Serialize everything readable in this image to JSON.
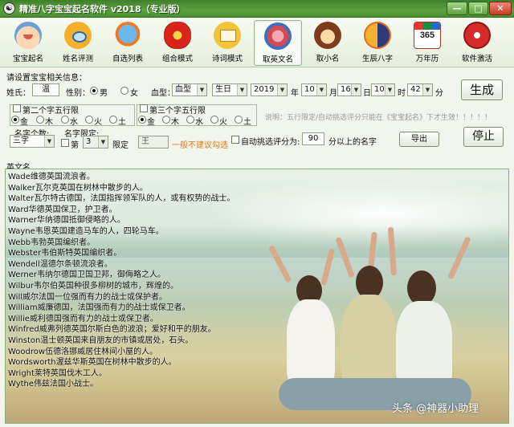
{
  "window": {
    "title": "精准八字宝宝起名软件 v2018（专业版）",
    "controls": {
      "minimize": "—",
      "maximize": "□",
      "close": "✕"
    }
  },
  "toolbar": {
    "items": [
      {
        "label": "宝宝起名",
        "icon": "baby-face-icon"
      },
      {
        "label": "姓名评测",
        "icon": "pig-magnifier-icon"
      },
      {
        "label": "自选列表",
        "icon": "bird-icon"
      },
      {
        "label": "组合模式",
        "icon": "lantern-icon"
      },
      {
        "label": "诗词模式",
        "icon": "book-icon"
      },
      {
        "label": "取英文名",
        "icon": "english-mascot-icon"
      },
      {
        "label": "取小名",
        "icon": "monkey-icon"
      },
      {
        "label": "生辰八字",
        "icon": "yinyang-icon"
      },
      {
        "label": "万年历",
        "icon": "calendar-365-icon"
      },
      {
        "label": "软件激活",
        "icon": "lock-icon"
      }
    ],
    "active": "取英文名"
  },
  "form": {
    "section_label": "请设置宝宝相关信息：",
    "surname_label": "姓氏：",
    "surname_value": "温",
    "gender_label": "性别：",
    "gender_options": [
      "男",
      "女"
    ],
    "gender_selected": "男",
    "blood_label": "血型：",
    "blood_value": "血型",
    "birth_type_value": "生日",
    "year_value": "2019",
    "year_unit": "年",
    "month_value": "10",
    "month_unit": "月",
    "day_value": "16",
    "day_unit": "日",
    "hour_value": "10",
    "hour_unit": "时",
    "minute_value": "42",
    "minute_unit": "分",
    "generate_label": "生成",
    "wuxing2_label": "第二个字五行限",
    "wuxing3_label": "第三个字五行限",
    "elements": [
      "金",
      "木",
      "水",
      "火",
      "土"
    ],
    "note": "说明：五行限定/自动挑选评分只能在《宝宝起名》下才生效！！！！！",
    "name_len_label": "名字个数:",
    "name_len_value": "三字",
    "name_limit_label": "名字限定:",
    "limit_pos_prefix": "第",
    "limit_pos_value": "3",
    "limit_pos_suffix": "限定",
    "limit_char_value": "王",
    "limit_hint": "一般不建议勾选",
    "auto_pick_label": "自动挑选评分为:",
    "auto_pick_value": "90",
    "auto_pick_suffix": "分以上的名字",
    "export_label": "导出",
    "stop_label": "停止"
  },
  "list": {
    "header": "英文名",
    "items": [
      "Wade维德英国流浪者。",
      "Walker瓦尔克英国在树林中散步的人。",
      "Walter瓦尔特古德国，法国指挥领军队的人，或有权势的战士。",
      "Ward华德英国保卫，护卫者。",
      "Warner华纳德国抵御侵略的人。",
      "Wayne韦恩英国建造马车的人，四轮马车。",
      "Webb韦勃英国编织者。",
      "Webster韦伯斯特英国编织者。",
      "Wendell温德尔条顿流浪者。",
      "Werner韦纳尔德国卫国卫邦，御侮略之人。",
      "Wilbur韦尔伯英国种很多柳树的城市，辉煌的。",
      "Will威尔法国一位强而有力的战士或保护者。",
      "William威廉德国，法国强而有力的战士或保卫者。",
      "Willie威利德国强而有力的战士或保卫者。",
      "Winfred威弗列德英国尔斯白色的波浪；爱好和平的朋友。",
      "Winston温士顿英国来自朋友的市镇或居处，石头。",
      "Woodrow伍德洛挪威居住林间小屋的人。",
      "Wordsworth渥兹华斯英国在树林中散步的人。",
      "Wright莱特英国伐木工人。",
      "Wythe伟兹法国小战士。"
    ]
  },
  "watermark": "头条 @神器小助理"
}
